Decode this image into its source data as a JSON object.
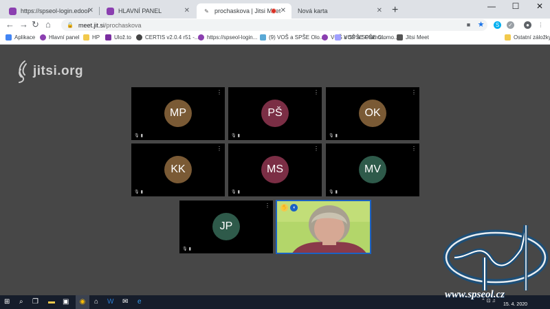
{
  "browser": {
    "tabs": [
      {
        "title": "https://spseol-login.edookit.net",
        "favicon": "edookit-icon"
      },
      {
        "title": "HLAVNÍ PANEL",
        "favicon": "edookit-icon"
      },
      {
        "title": "prochaskova | Jitsi Meet",
        "favicon": "jitsi-icon",
        "recording": true
      },
      {
        "title": "Nová karta",
        "favicon": "none"
      }
    ],
    "active_tab": 2,
    "address": {
      "host": "meet.jit.si",
      "path": "/prochaskova"
    },
    "bookmarks": [
      {
        "label": "Aplikace",
        "color": "#4285f4"
      },
      {
        "label": "Hlavní panel",
        "color": "#8b3fb0"
      },
      {
        "label": "HP",
        "color": "#f2c94c"
      },
      {
        "label": "Ulož.to",
        "color": "#7b2ea1"
      },
      {
        "label": "CERTIS v2.0.4 r51 -...",
        "color": "#444444"
      },
      {
        "label": "https://spseol-login...",
        "color": "#8b3fb0"
      },
      {
        "label": "(9) VOŠ a SPŠE Olo...",
        "color": "#5aa9d6"
      },
      {
        "label": "VOŠ a SPŠE Olomo...",
        "color": "#8b3fb0"
      },
      {
        "label": "VOŠ a SPŠE Olomo...",
        "color": "#a0a0ff"
      },
      {
        "label": "Jitsi Meet",
        "color": "#555555"
      }
    ],
    "other_bookmarks": "Ostatní záložky"
  },
  "meeting": {
    "logo_text": "jitsi.org",
    "participants": [
      {
        "initials": "MP",
        "color": "#7a5a35"
      },
      {
        "initials": "PŠ",
        "color": "#7b2e45"
      },
      {
        "initials": "OK",
        "color": "#7a5a35"
      },
      {
        "initials": "KK",
        "color": "#7a5a35"
      },
      {
        "initials": "MS",
        "color": "#7b2e45"
      },
      {
        "initials": "MV",
        "color": "#2e5a4a"
      },
      {
        "initials": "JP",
        "color": "#2e5a4a"
      }
    ]
  },
  "watermark": {
    "text": "www.spseol.cz"
  },
  "taskbar": {
    "date": "15. 4. 2020"
  }
}
